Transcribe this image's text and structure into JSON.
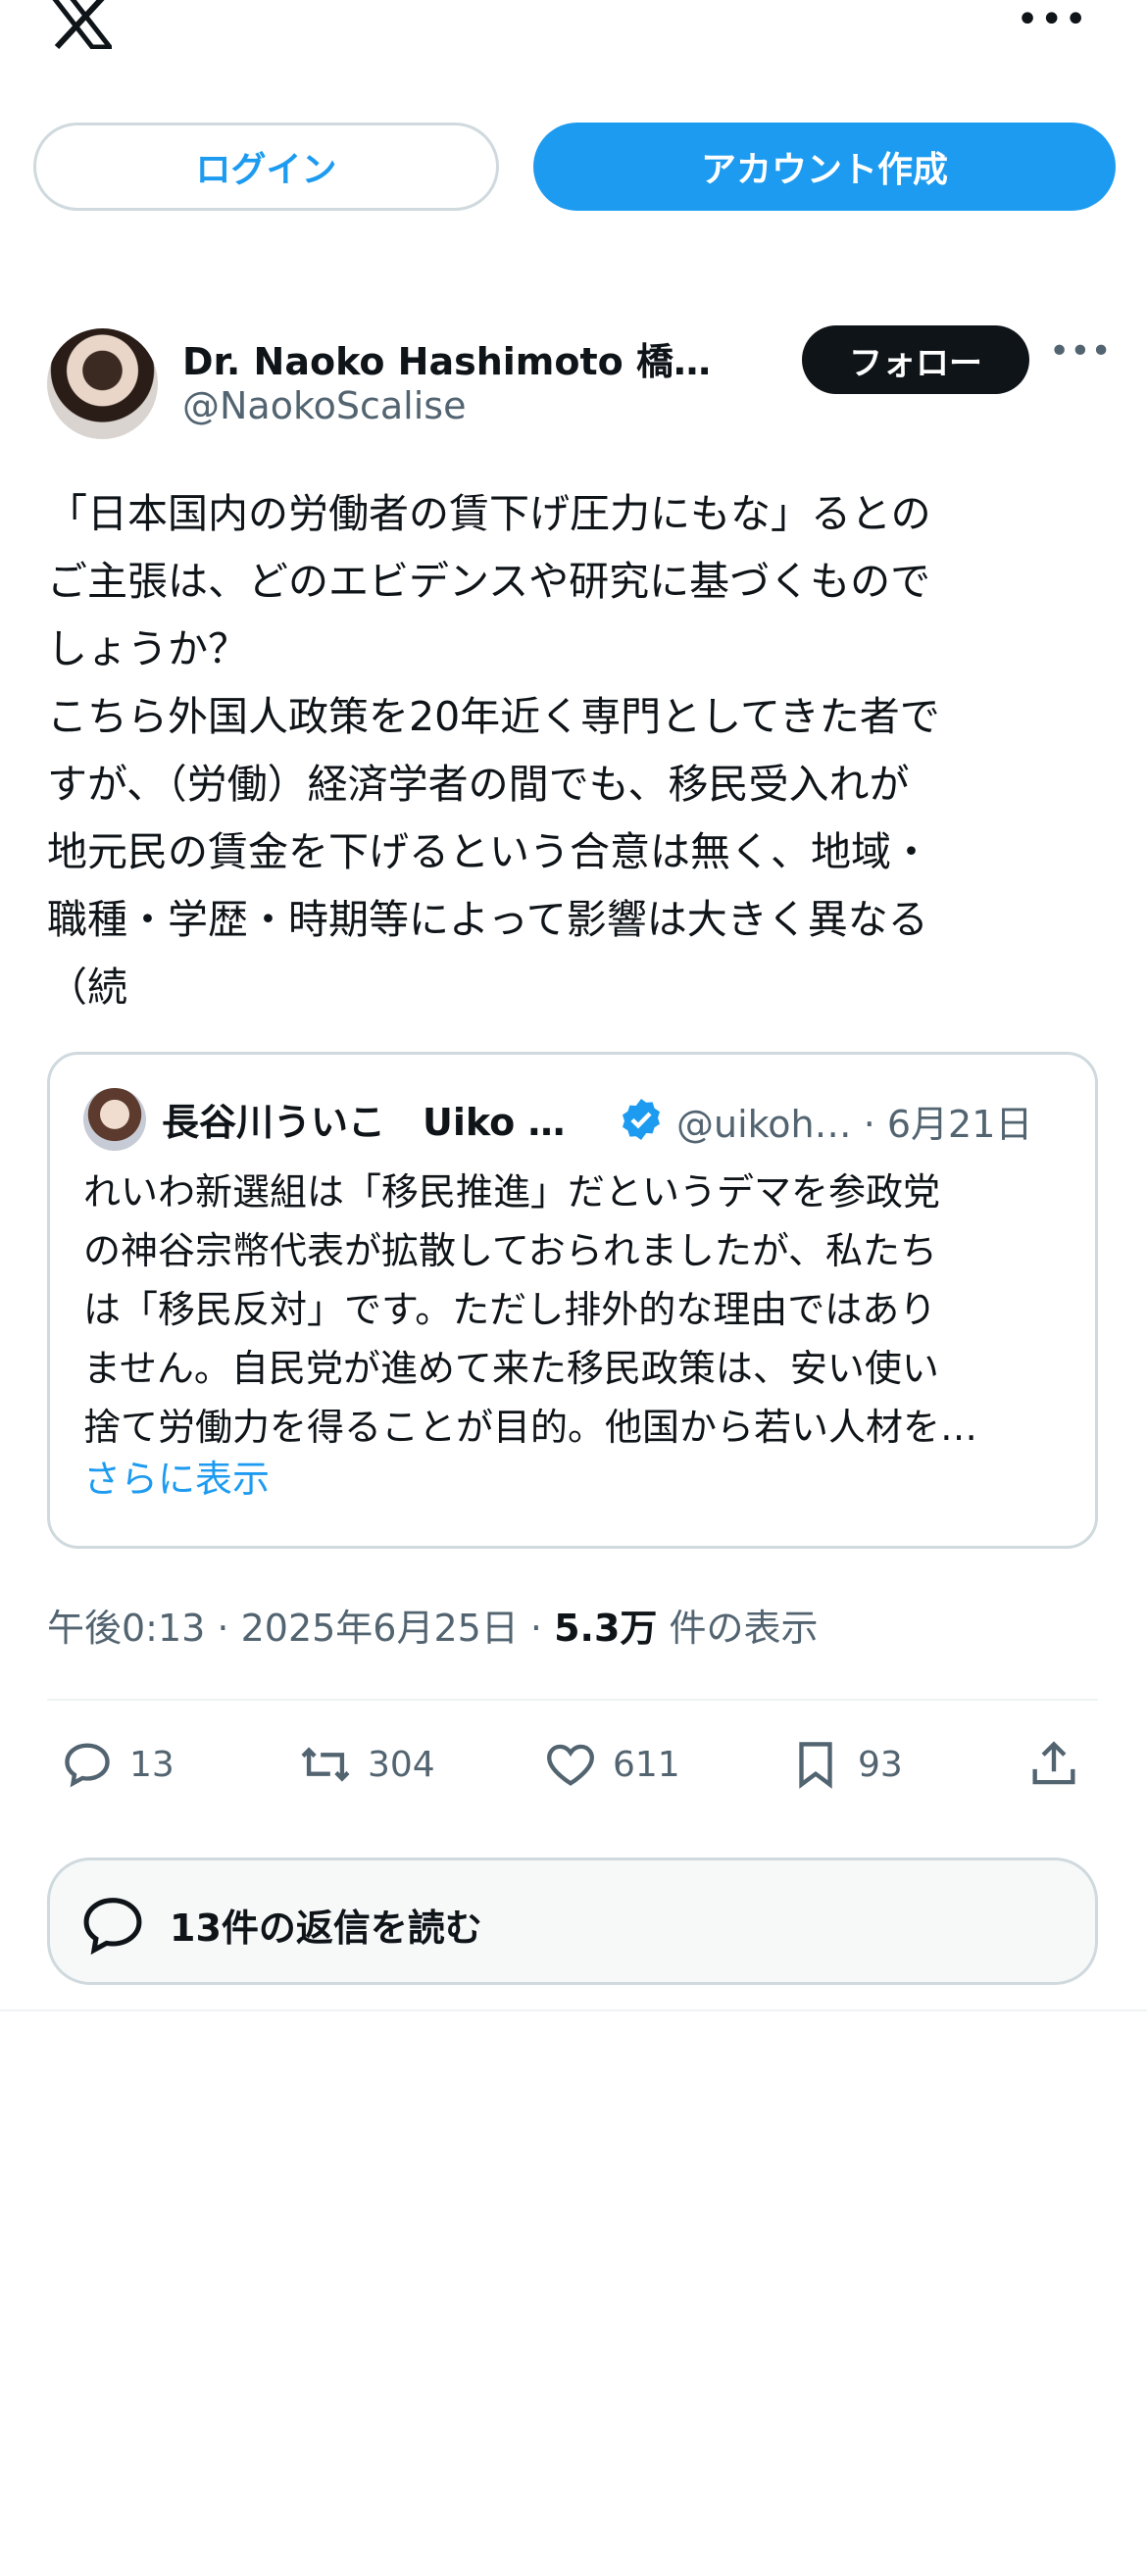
{
  "header": {
    "logo": "x-logo",
    "more_menu": "•••"
  },
  "auth": {
    "login_label": "ログイン",
    "signup_label": "アカウント作成"
  },
  "tweet": {
    "author_name": "Dr. Naoko Hashimoto 橋…",
    "author_handle": "@NaokoScalise",
    "follow_label": "フォロー",
    "more": "•••",
    "text": "「日本国内の労働者の賃下げ圧力にもな」るとの\nご主張は、どのエビデンスや研究に基づくもので\nしょうか？\nこちら外国人政策を20年近く専門としてきた者で\nすが、（労働）経済学者の間でも、移民受入れが\n地元民の賃金を下げるという合意は無く、地域・\n職種・学歴・時期等によって影響は大きく異なる\n（続",
    "time": "午後0:13",
    "date": "2025年6月25日",
    "views_count": "5.3万",
    "views_label": "件の表示"
  },
  "quote": {
    "name": "長谷川ういこ　Uiko …",
    "handle_date": "@uikoh… · 6月21日",
    "lines": [
      "れいわ新選組は「移民推進」だというデマを参政党",
      "の神谷宗幣代表が拡散しておられましたが、私たち",
      "は「移民反対」です。ただし排外的な理由ではあり",
      "ません。自民党が進めて来た移民政策は、安い使い",
      "捨て労働力を得ることが目的。他国から若い人材を…"
    ],
    "show_more": "さらに表示"
  },
  "actions": {
    "replies": "13",
    "reposts": "304",
    "likes": "611",
    "bookmarks": "93"
  },
  "read_replies_label": "13件の返信を読む",
  "colors": {
    "accent": "#1d9bf0",
    "text": "#0f1419",
    "secondary": "#536471",
    "border": "#cfd9de"
  }
}
